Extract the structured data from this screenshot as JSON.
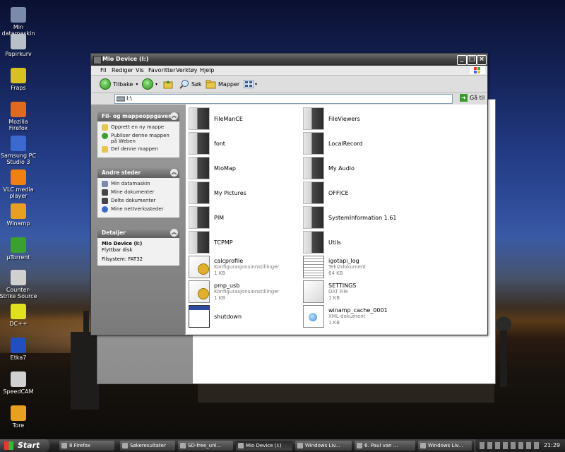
{
  "desktop": {
    "icons": [
      {
        "label": "Min datamaskin",
        "icon": "computer-icon",
        "color": "#7a8aa8"
      },
      {
        "label": "Papirkurv",
        "icon": "recycle-bin-icon",
        "color": "#b8c0c8"
      },
      {
        "label": "Fraps",
        "icon": "fraps-icon",
        "color": "#d8c020"
      },
      {
        "label": "Mozilla Firefox",
        "icon": "firefox-icon",
        "color": "#e06a20"
      },
      {
        "label": "Samsung PC Studio 3",
        "icon": "samsung-icon",
        "color": "#3a6ad0"
      },
      {
        "label": "VLC media player",
        "icon": "vlc-icon",
        "color": "#f08010"
      },
      {
        "label": "Winamp",
        "icon": "winamp-icon",
        "color": "#e8a020"
      },
      {
        "label": "µTorrent",
        "icon": "utorrent-icon",
        "color": "#3aa030"
      },
      {
        "label": "Counter-Strike Source",
        "icon": "counter-strike-icon",
        "color": "#d0d0d0"
      },
      {
        "label": "DC++",
        "icon": "dcpp-icon",
        "color": "#e0e020"
      },
      {
        "label": "Etka7",
        "icon": "etka-icon",
        "color": "#2050c0"
      },
      {
        "label": "SpeedCAM",
        "icon": "speedcam-icon",
        "color": "#d0d0d0"
      },
      {
        "label": "Tore",
        "icon": "tore-icon",
        "color": "#e8a020"
      }
    ]
  },
  "window": {
    "title": "Mio Device (I:)",
    "menu": [
      "Fil",
      "Rediger",
      "Vis",
      "Favoritter",
      "Verktøy",
      "Hjelp"
    ],
    "toolbar": {
      "back": "Tilbake",
      "search": "Søk",
      "folders": "Mapper"
    },
    "address": {
      "value": "I:\\",
      "go": "Gå til"
    }
  },
  "left_pane": {
    "tasks": {
      "header": "Fil- og mappeoppgaver",
      "items": [
        "Opprett en ny mappe",
        "Publiser denne mappen på Weben",
        "Del denne mappen"
      ]
    },
    "other_places": {
      "header": "Andre steder",
      "items": [
        "Min datamaskin",
        "Mine dokumenter",
        "Delte dokumenter",
        "Mine nettverkssteder"
      ]
    },
    "details": {
      "header": "Detaljer",
      "name": "Mio Device (I:)",
      "type": "Flyttbar disk",
      "fs": "Filsystem: FAT32"
    }
  },
  "files": [
    {
      "name": "FileManCE",
      "type": "",
      "size": "",
      "kind": "folder"
    },
    {
      "name": "FileViewers",
      "type": "",
      "size": "",
      "kind": "folder"
    },
    {
      "name": "font",
      "type": "",
      "size": "",
      "kind": "folder"
    },
    {
      "name": "LocalRecord",
      "type": "",
      "size": "",
      "kind": "folder"
    },
    {
      "name": "MioMap",
      "type": "",
      "size": "",
      "kind": "folder"
    },
    {
      "name": "My Audio",
      "type": "",
      "size": "",
      "kind": "folder"
    },
    {
      "name": "My Pictures",
      "type": "",
      "size": "",
      "kind": "folder"
    },
    {
      "name": "OFFICE",
      "type": "",
      "size": "",
      "kind": "folder"
    },
    {
      "name": "PIM",
      "type": "",
      "size": "",
      "kind": "folder"
    },
    {
      "name": "SystemInformation 1.61",
      "type": "",
      "size": "",
      "kind": "folder"
    },
    {
      "name": "TCPMP",
      "type": "",
      "size": "",
      "kind": "folder"
    },
    {
      "name": "Utils",
      "type": "",
      "size": "",
      "kind": "folder"
    },
    {
      "name": "calcprofile",
      "type": "Konfigurasjonsinnstillinger",
      "size": "1 KB",
      "kind": "cfg"
    },
    {
      "name": "igotapi_log",
      "type": "Tekstdokument",
      "size": "64 KB",
      "kind": "txt"
    },
    {
      "name": "pmp_usb",
      "type": "Konfigurasjonsinnstillinger",
      "size": "1 KB",
      "kind": "cfg"
    },
    {
      "name": "SETTINGS",
      "type": "DAT File",
      "size": "1 KB",
      "kind": "dat"
    },
    {
      "name": "shutdown",
      "type": "",
      "size": "",
      "kind": "exe"
    },
    {
      "name": "winamp_cache_0001",
      "type": "XML-dokument",
      "size": "1 KB",
      "kind": "xml"
    }
  ],
  "taskbar": {
    "start": "Start",
    "buttons": [
      {
        "label": "8 Firefox",
        "active": false
      },
      {
        "label": "Søkeresultater",
        "active": false
      },
      {
        "label": "SD-free_unl...",
        "active": false
      },
      {
        "label": "Mio Device (I:)",
        "active": true
      },
      {
        "label": "Windows Liv...",
        "active": false
      },
      {
        "label": "6. Paul van ...",
        "active": false
      },
      {
        "label": "Windows Liv...",
        "active": false
      }
    ],
    "clock": "21:29"
  }
}
